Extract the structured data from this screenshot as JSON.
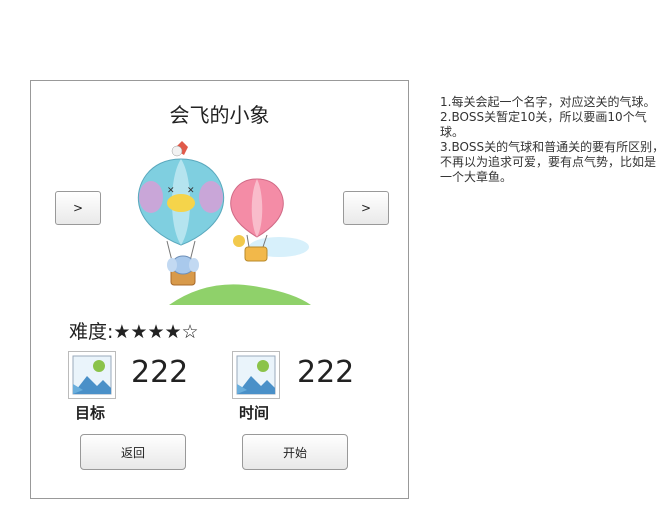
{
  "level_card": {
    "title": "会飞的小象",
    "prev_label": ">",
    "next_label": ">",
    "difficulty_text": "难度:★★★★☆",
    "goal": {
      "value": "222",
      "label": "目标"
    },
    "time": {
      "value": "222",
      "label": "时间"
    },
    "back_label": "返回",
    "start_label": "开始"
  },
  "notes": [
    "1.每关会起一个名字，对应这关的气球。",
    "2.BOSS关暂定10关，所以要画10个气球。",
    "3.BOSS关的气球和普通关的要有所区别，不再以为追求可爱，要有点气势，比如是一个大章鱼。"
  ],
  "colors": {
    "border": "#999999",
    "balloon_left": "#7fcfe0",
    "balloon_right": "#f48ca6",
    "elephant": "#a9c9ec",
    "placeholder_sky": "#4a90c8",
    "placeholder_sun": "#8bc34a"
  },
  "icons": [
    "image-placeholder-icon",
    "elephant-balloon-illustration"
  ]
}
